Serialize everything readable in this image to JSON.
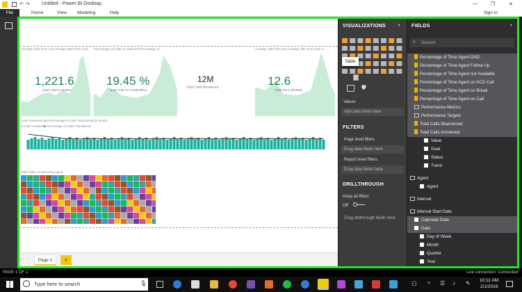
{
  "app": {
    "title": "Untitled - Power BI Desktop"
  },
  "window_controls": {
    "signin": "Sign in"
  },
  "menu": [
    "File",
    "Home",
    "View",
    "Modeling",
    "Help"
  ],
  "report": {
    "chart_titles": [
      "Average Hold Time and Average Wait Time Goal",
      "Percentage of Calls on Hold and Percentage of...",
      "Average Talk Time and Average Talk Time Goal S...",
      "Calls Answered and Percentage of Calls Transferred by Month",
      "Total Calls Answered by Agent"
    ],
    "kpi1": {
      "value": "1,221.6",
      "goal": "Goal: 120.0 (+918%)"
    },
    "kpi2": {
      "value": "19.45 %",
      "goal": "Goal: 0.50 % (+3789.00%)"
    },
    "card": {
      "value": "12M",
      "label": "Total Calls Answered"
    },
    "kpi3": {
      "value": "12.6",
      "goal": "Goal: 9.0 (+39.99%)"
    },
    "legend": [
      "Calls Answered",
      "Percentage of Calls Transferred"
    ],
    "page_tab": "Page 1",
    "add_page": "+"
  },
  "tooltip": "Table",
  "visualizations": {
    "title": "VISUALIZATIONS",
    "values_label": "Values",
    "values_drop": "Add data fields here",
    "filters_title": "FILTERS",
    "page_filters": "Page level filters",
    "page_drop": "Drag data fields here",
    "report_filters": "Report level filters",
    "report_drop": "Drag data fields here",
    "drill_title": "DRILLTHROUGH",
    "keep_all": "Keep all filters",
    "toggle": "Off",
    "drill_drop": "Drag drillthrough fields here"
  },
  "fields": {
    "title": "FIELDS",
    "search_placeholder": "Search",
    "items": [
      "Percentage of Time Agent DND",
      "Percentage of Time Agent Follow Up",
      "Percentage of Time Agent not Available",
      "Percentage of Time Agent on ACD Call",
      "Percentage of Time Agent on Break",
      "Percentage of Time Agent on Call",
      "Performance Metrics",
      "Performance Targets",
      "Total Calls Abandoned",
      "Total Calls Answered",
      "Value",
      "Goal",
      "Status",
      "Trend",
      "Agent",
      "Agent",
      "Interval",
      "Interval Start Date",
      "Calendar Date",
      "Date",
      "Day of Week",
      "Month",
      "Quarter",
      "Year"
    ]
  },
  "status": {
    "page": "PAGE 1 OF 1",
    "live": "Live connection: Connected"
  },
  "taskbar": {
    "search": "Type here to search",
    "time": "10:11 AM",
    "date": "2/1/2019"
  },
  "colors": {
    "accent": "#1a7f5a",
    "frame": "#22e822",
    "bars": "#19b39a"
  }
}
